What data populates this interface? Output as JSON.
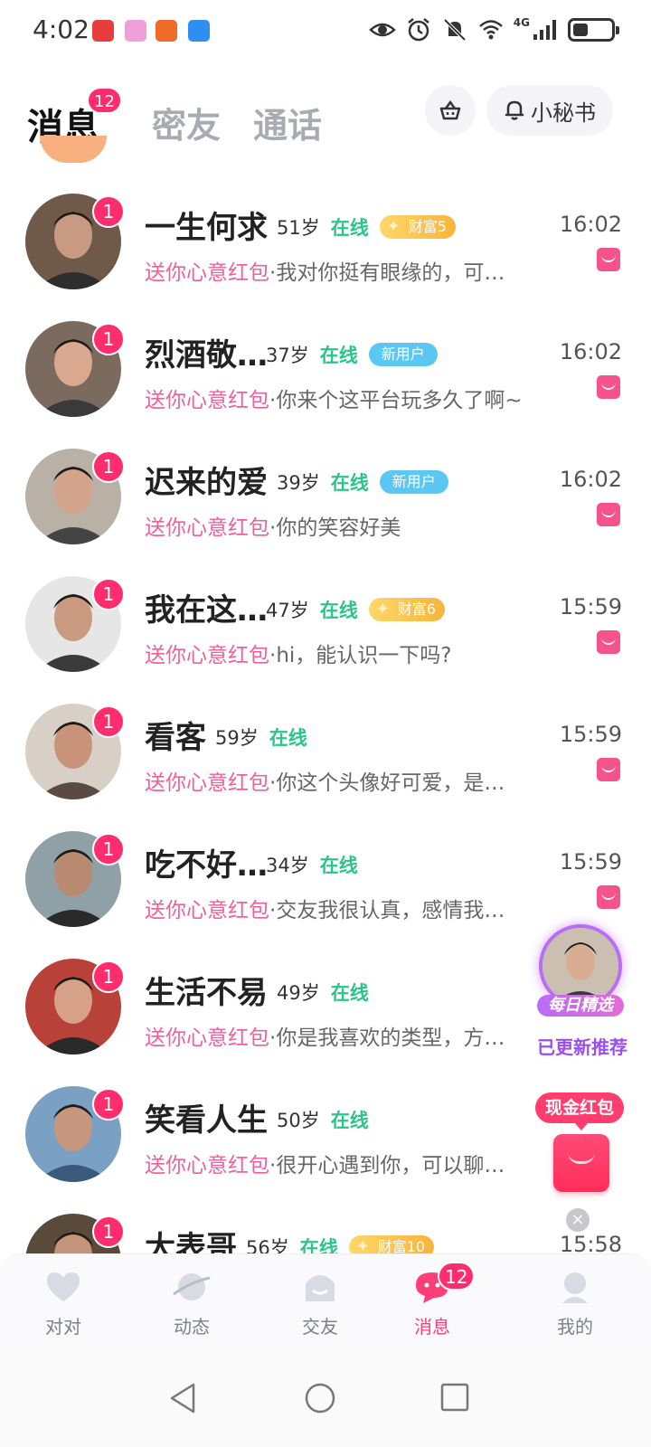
{
  "status_bar": {
    "time": "4:02",
    "network": "4G",
    "icons": [
      "huawei-app-icon",
      "chat-app-icon",
      "game-app-icon",
      "weather-app-icon",
      "eye-icon",
      "alarm-icon",
      "mute-icon",
      "wifi-icon",
      "signal-icon",
      "battery-icon"
    ]
  },
  "header": {
    "tabs": [
      {
        "label": "消息",
        "badge": "12",
        "active": true
      },
      {
        "label": "密友"
      },
      {
        "label": "通话"
      }
    ],
    "basket_button": "basket-icon",
    "secretary_label": "小秘书"
  },
  "conversations": [
    {
      "name": "一生何求",
      "age": "51岁",
      "status": "在线",
      "tag": "财富5",
      "tag_type": "wealth",
      "time": "16:02",
      "unread": "1",
      "gift": "送你心意红包",
      "sep": "·",
      "message": "我对你挺有眼缘的，可…",
      "avatar_bg": "#6f5a4a",
      "face": "#c89a82",
      "shirt": "#2e2e2e"
    },
    {
      "name": "烈酒敬…",
      "age": "37岁",
      "status": "在线",
      "tag": "新用户",
      "tag_type": "new",
      "time": "16:02",
      "unread": "1",
      "gift": "送你心意红包",
      "sep": "·",
      "message": "你来个这平台玩多久了啊~",
      "avatar_bg": "#7a6b5e",
      "face": "#d9a88e",
      "shirt": "#3a3a3a"
    },
    {
      "name": "迟来的爱",
      "age": "39岁",
      "status": "在线",
      "tag": "新用户",
      "tag_type": "new",
      "time": "16:02",
      "unread": "1",
      "gift": "送你心意红包",
      "sep": "·",
      "message": "你的笑容好美",
      "avatar_bg": "#b9b0a6",
      "face": "#d4a48a",
      "shirt": "#444444"
    },
    {
      "name": "我在这…",
      "age": "47岁",
      "status": "在线",
      "tag": "财富6",
      "tag_type": "wealth",
      "time": "15:59",
      "unread": "1",
      "gift": "送你心意红包",
      "sep": "·",
      "message": "hi，能认识一下吗?",
      "avatar_bg": "#e6e6e6",
      "face": "#c99a80",
      "shirt": "#3a3a3a"
    },
    {
      "name": "看客",
      "age": "59岁",
      "status": "在线",
      "tag": "",
      "tag_type": "",
      "time": "15:59",
      "unread": "1",
      "gift": "送你心意红包",
      "sep": "·",
      "message": "你这个头像好可爱，是…",
      "avatar_bg": "#d8cfc6",
      "face": "#c9937a",
      "shirt": "#5a4a44"
    },
    {
      "name": "吃不好…",
      "age": "34岁",
      "status": "在线",
      "tag": "",
      "tag_type": "",
      "time": "15:59",
      "unread": "1",
      "gift": "送你心意红包",
      "sep": "·",
      "message": "交友我很认真，感情我…",
      "avatar_bg": "#8fa0a6",
      "face": "#b98a70",
      "shirt": "#2a2a2a"
    },
    {
      "name": "生活不易",
      "age": "49岁",
      "status": "在线",
      "tag": "",
      "tag_type": "",
      "time": "",
      "unread": "1",
      "gift": "送你心意红包",
      "sep": "·",
      "message": "你是我喜欢的类型，方…",
      "avatar_bg": "#b8423a",
      "face": "#d6a186",
      "shirt": "#2a2a2a"
    },
    {
      "name": "笑看人生",
      "age": "50岁",
      "status": "在线",
      "tag": "",
      "tag_type": "",
      "time": "",
      "unread": "1",
      "gift": "送你心意红包",
      "sep": "·",
      "message": "很开心遇到你，可以聊…",
      "avatar_bg": "#7aa0c4",
      "face": "#c6977c",
      "shirt": "#3a5a7a"
    },
    {
      "name": "大表哥",
      "age": "56岁",
      "status": "在线",
      "tag": "财富10",
      "tag_type": "wealth",
      "time": "15:58",
      "unread": "1",
      "gift": "",
      "sep": "",
      "message": "",
      "avatar_bg": "#5a4a3a",
      "face": "#c49478",
      "shirt": "#2a2a2a"
    }
  ],
  "floating": {
    "daily_pick_badge": "每日精选",
    "daily_pick_sub": "已更新推荐",
    "cash_packet_label": "现金红包"
  },
  "bottom_nav": [
    {
      "label": "对对",
      "icon": "heart-icon",
      "active": false
    },
    {
      "label": "动态",
      "icon": "planet-icon",
      "active": false
    },
    {
      "label": "交友",
      "icon": "friends-icon",
      "active": false
    },
    {
      "label": "消息",
      "icon": "message-icon",
      "active": true,
      "badge": "12"
    },
    {
      "label": "我的",
      "icon": "profile-icon",
      "active": false
    }
  ],
  "colors": {
    "accent": "#ff3d78",
    "online": "#2bc48a",
    "gift": "#f0609a",
    "new_tag": "#5ac8f2",
    "wealth_tag": "#f7b43a"
  }
}
